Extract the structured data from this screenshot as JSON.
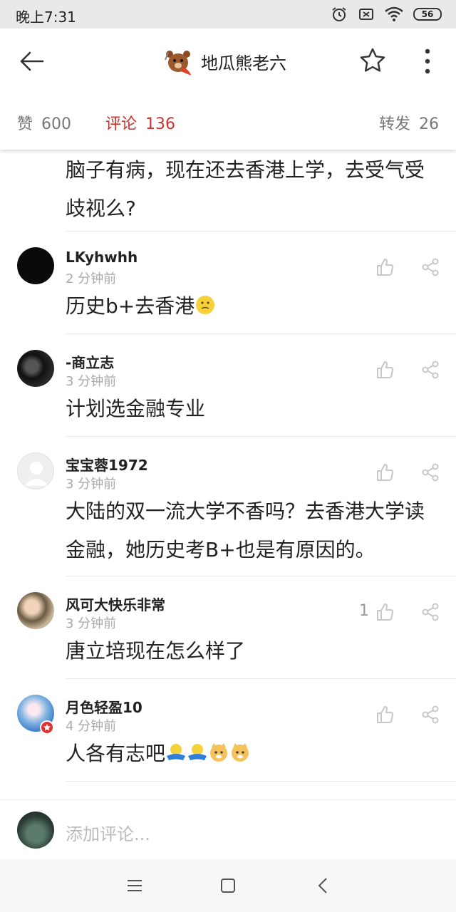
{
  "status": {
    "time": "晚上7:31",
    "battery": "56"
  },
  "header": {
    "title": "地瓜熊老六"
  },
  "stats": {
    "likes_label": "赞",
    "likes_count": "600",
    "comments_label": "评论",
    "comments_count": "136",
    "reposts_label": "转发",
    "reposts_count": "26"
  },
  "previous_text": "脑子有病，现在还去香港上学，去受气受歧视么?",
  "comments": [
    {
      "name": "LKyhwhh",
      "time": "2 分钟前",
      "text": "历史b+去香港",
      "likes": ""
    },
    {
      "name": "-商立志",
      "time": "3 分钟前",
      "text": "计划选金融专业",
      "likes": ""
    },
    {
      "name": "宝宝蓉1972",
      "time": "3 分钟前",
      "text": "大陆的双一流大学不香吗？去香港大学读金融，她历史考B+也是有原因的。",
      "likes": ""
    },
    {
      "name": "风可大快乐非常",
      "time": "3 分钟前",
      "text": "唐立培现在怎么样了",
      "likes": "1"
    },
    {
      "name": "月色轻盈10",
      "time": "4 分钟前",
      "text": "人各有志吧",
      "likes": ""
    }
  ],
  "input": {
    "placeholder": "添加评论..."
  },
  "colors": {
    "accent": "#d0312d",
    "muted": "#777777"
  }
}
